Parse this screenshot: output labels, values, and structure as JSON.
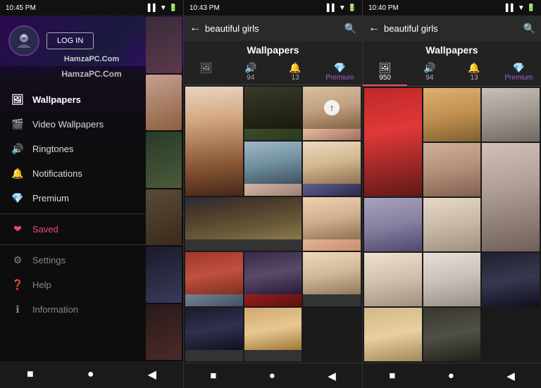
{
  "leftPanel": {
    "statusBar": {
      "time": "10:45 PM",
      "icons": "▌▌ ▼ ⬡"
    },
    "loginButton": "LOG IN",
    "watermark": "HamzaPC.Com",
    "menuItems": [
      {
        "id": "wallpapers",
        "icon": "🖼",
        "label": "Wallpapers",
        "active": true
      },
      {
        "id": "video-wallpapers",
        "icon": "🎬",
        "label": "Video Wallpapers",
        "active": false
      },
      {
        "id": "ringtones",
        "icon": "🔊",
        "label": "Ringtones",
        "active": false
      },
      {
        "id": "notifications",
        "icon": "🔔",
        "label": "Notifications",
        "active": false
      },
      {
        "id": "premium",
        "icon": "💎",
        "label": "Premium",
        "active": false
      },
      {
        "id": "saved",
        "icon": "❤",
        "label": "Saved",
        "active": false
      },
      {
        "id": "settings",
        "icon": "⚙",
        "label": "Settings",
        "dim": true
      },
      {
        "id": "help",
        "icon": "❓",
        "label": "Help",
        "dim": true
      },
      {
        "id": "information",
        "icon": "ℹ",
        "label": "Information",
        "dim": true
      }
    ],
    "bottomNav": [
      "■",
      "●",
      "◀"
    ]
  },
  "middlePanel": {
    "statusBar": {
      "time": "10:43 PM"
    },
    "searchBar": {
      "backArrow": "←",
      "query": "beautiful girls",
      "searchIcon": "🔍"
    },
    "sectionTitle": "Wallpapers",
    "tabs": [
      {
        "id": "wallpapers",
        "icon": "🖼",
        "count": "",
        "label": "",
        "active": false
      },
      {
        "id": "ringtones",
        "icon": "🔊",
        "count": "94",
        "label": "",
        "active": false
      },
      {
        "id": "notifications",
        "icon": "🔔",
        "count": "13",
        "label": "",
        "active": false
      },
      {
        "id": "premium",
        "icon": "💎",
        "count": "Premium",
        "label": "Premium",
        "active": false
      }
    ],
    "bottomNav": [
      "■",
      "●",
      "◀"
    ]
  },
  "rightPanel": {
    "statusBar": {
      "time": "10:40 PM"
    },
    "searchBar": {
      "backArrow": "←",
      "query": "beautiful girls",
      "searchIcon": "🔍"
    },
    "sectionTitle": "Wallpapers",
    "tabs": [
      {
        "id": "wallpapers",
        "icon": "🖼",
        "count": "950",
        "label": "950",
        "active": true
      },
      {
        "id": "ringtones",
        "icon": "🔊",
        "count": "94",
        "label": "94",
        "active": false
      },
      {
        "id": "notifications",
        "icon": "🔔",
        "count": "13",
        "label": "13",
        "active": false
      },
      {
        "id": "premium",
        "icon": "💎",
        "count": "Premium",
        "label": "Premium",
        "active": false
      }
    ],
    "bottomNav": [
      "■",
      "●",
      "◀"
    ]
  }
}
